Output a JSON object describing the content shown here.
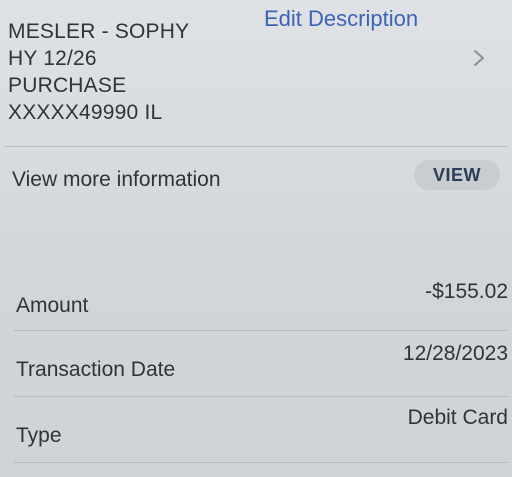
{
  "description": {
    "lines": [
      "MESLER - SOPHY",
      "HY 12/26",
      "PURCHASE",
      "XXXXX49990 IL"
    ],
    "edit_label": "Edit Description"
  },
  "more_info": {
    "label": "View more information",
    "button_label": "VIEW"
  },
  "details": [
    {
      "label": "Amount",
      "value": "-$155.02"
    },
    {
      "label": "Transaction Date",
      "value": "12/28/2023"
    },
    {
      "label": "Type",
      "value": "Debit Card"
    }
  ],
  "icons": {
    "chevron": "chevron-right-icon"
  }
}
